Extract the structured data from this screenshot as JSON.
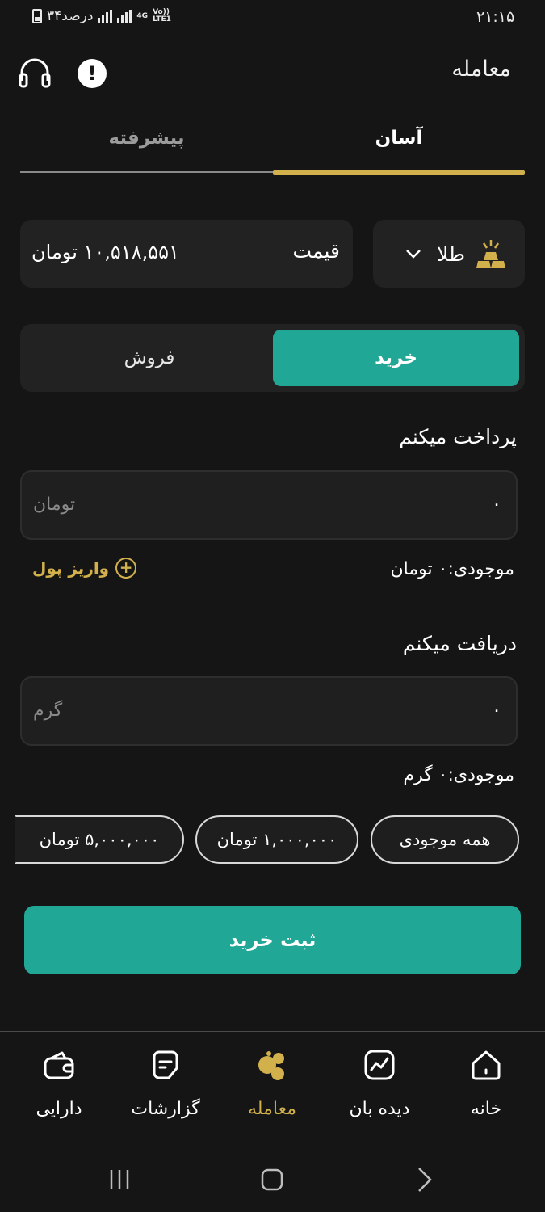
{
  "status_bar": {
    "time": "۲۱:۱۵",
    "battery_text": "۳۴درصد",
    "network": "4G",
    "network2": "Vo)) LTE1"
  },
  "header": {
    "title": "معامله",
    "support_icon": "headset-icon",
    "info_icon": "alert-icon",
    "info_glyph": "!"
  },
  "tabs": [
    {
      "label": "آسان",
      "active": true
    },
    {
      "label": "پیشرفته",
      "active": false
    }
  ],
  "asset": {
    "label": "طلا",
    "icon": "gold-bars-icon"
  },
  "price": {
    "label": "قیمت",
    "value": "۱۰,۵۱۸,۵۵۱ تومان"
  },
  "trade_type": {
    "buy": "خرید",
    "sell": "فروش",
    "selected": "buy"
  },
  "pay": {
    "label": "پرداخت میکنم",
    "value": "۰",
    "unit": "تومان",
    "balance": "موجودی:۰ تومان",
    "deposit_label": "واریز پول"
  },
  "receive": {
    "label": "دریافت میکنم",
    "value": "۰",
    "unit": "گرم",
    "balance": "موجودی:۰ گرم"
  },
  "quick_amounts": [
    "همه موجودی",
    "۱,۰۰۰,۰۰۰ تومان",
    "۵,۰۰۰,۰۰۰ تومان"
  ],
  "submit_label": "ثبت خرید",
  "bottom_nav": [
    {
      "label": "خانه",
      "icon": "home-icon",
      "active": false
    },
    {
      "label": "دیده بان",
      "icon": "watchlist-chart-icon",
      "active": false
    },
    {
      "label": "معامله",
      "icon": "trade-coins-icon",
      "active": true
    },
    {
      "label": "گزارشات",
      "icon": "reports-icon",
      "active": false
    },
    {
      "label": "دارایی",
      "icon": "wallet-icon",
      "active": false
    }
  ],
  "colors": {
    "accent_gold": "#d2b04c",
    "accent_teal": "#21a796",
    "background": "#151515"
  }
}
